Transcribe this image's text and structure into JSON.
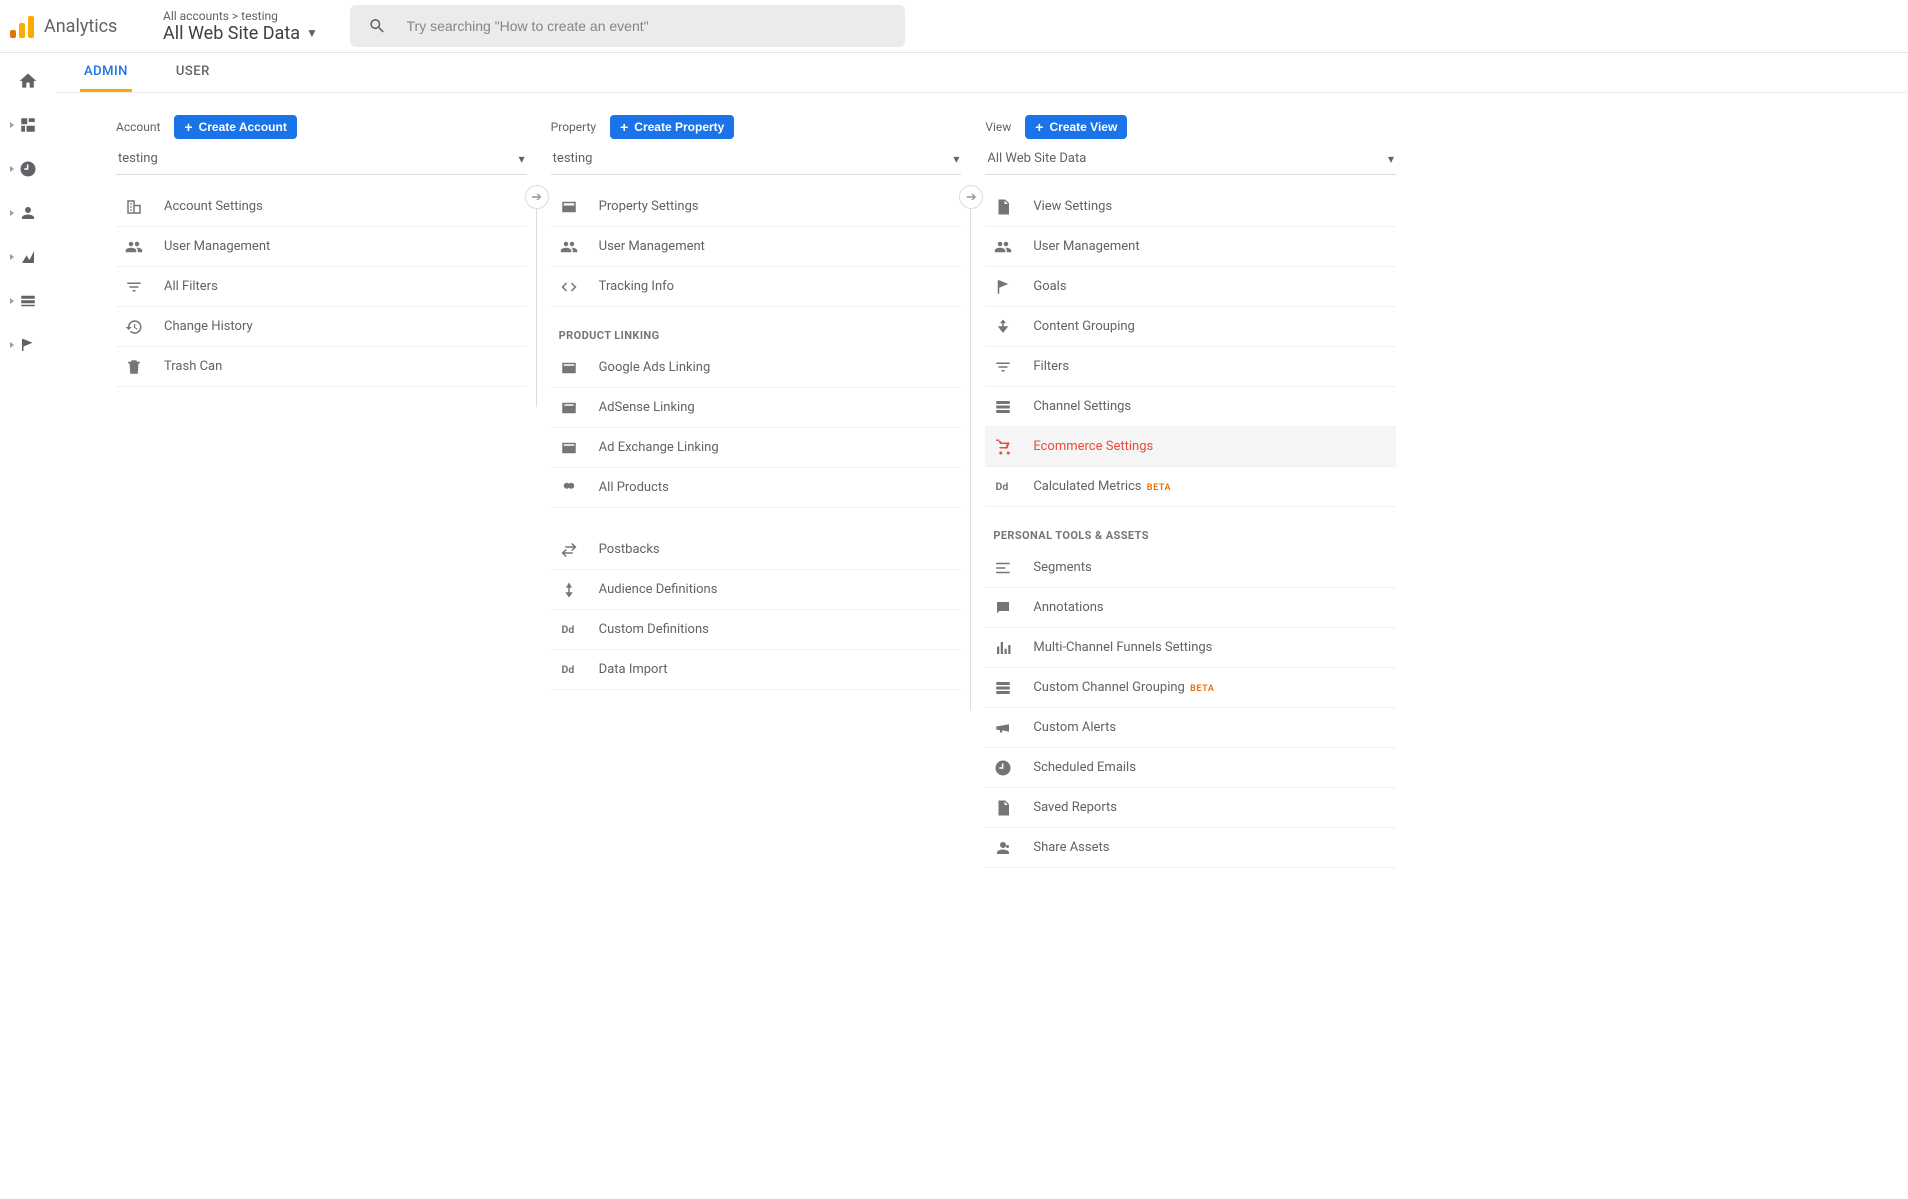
{
  "header": {
    "product_name": "Analytics",
    "breadcrumb_top": "All accounts > testing",
    "breadcrumb_main": "All Web Site Data",
    "search_placeholder": "Try searching \"How to create an event\""
  },
  "tabs": {
    "admin": "ADMIN",
    "user": "USER"
  },
  "columns": {
    "account": {
      "label": "Account",
      "create": "Create Account",
      "selector": "testing",
      "items": [
        {
          "id": "account-settings",
          "label": "Account Settings"
        },
        {
          "id": "account-user-management",
          "label": "User Management"
        },
        {
          "id": "account-all-filters",
          "label": "All Filters"
        },
        {
          "id": "account-change-history",
          "label": "Change History"
        },
        {
          "id": "account-trash-can",
          "label": "Trash Can"
        }
      ]
    },
    "property": {
      "label": "Property",
      "create": "Create Property",
      "selector": "testing",
      "items_main": [
        {
          "id": "property-settings",
          "label": "Property Settings"
        },
        {
          "id": "property-user-management",
          "label": "User Management"
        },
        {
          "id": "property-tracking-info",
          "label": "Tracking Info"
        }
      ],
      "section_product_linking": "PRODUCT LINKING",
      "items_linking": [
        {
          "id": "google-ads-linking",
          "label": "Google Ads Linking"
        },
        {
          "id": "adsense-linking",
          "label": "AdSense Linking"
        },
        {
          "id": "ad-exchange-linking",
          "label": "Ad Exchange Linking"
        },
        {
          "id": "all-products",
          "label": "All Products"
        }
      ],
      "items_lower": [
        {
          "id": "postbacks",
          "label": "Postbacks"
        },
        {
          "id": "audience-definitions",
          "label": "Audience Definitions"
        },
        {
          "id": "custom-definitions",
          "label": "Custom Definitions"
        },
        {
          "id": "data-import",
          "label": "Data Import"
        }
      ]
    },
    "view": {
      "label": "View",
      "create": "Create View",
      "selector": "All Web Site Data",
      "items_main": [
        {
          "id": "view-settings",
          "label": "View Settings"
        },
        {
          "id": "view-user-management",
          "label": "User Management"
        },
        {
          "id": "goals",
          "label": "Goals"
        },
        {
          "id": "content-grouping",
          "label": "Content Grouping"
        },
        {
          "id": "filters",
          "label": "Filters"
        },
        {
          "id": "channel-settings",
          "label": "Channel Settings"
        },
        {
          "id": "ecommerce-settings",
          "label": "Ecommerce Settings",
          "highlight": true
        },
        {
          "id": "calculated-metrics",
          "label": "Calculated Metrics",
          "badge": "BETA"
        }
      ],
      "section_personal": "PERSONAL TOOLS & ASSETS",
      "items_personal": [
        {
          "id": "segments",
          "label": "Segments"
        },
        {
          "id": "annotations",
          "label": "Annotations"
        },
        {
          "id": "mcf-settings",
          "label": "Multi-Channel Funnels Settings"
        },
        {
          "id": "custom-channel-grouping",
          "label": "Custom Channel Grouping",
          "badge": "BETA"
        },
        {
          "id": "custom-alerts",
          "label": "Custom Alerts"
        },
        {
          "id": "scheduled-emails",
          "label": "Scheduled Emails"
        },
        {
          "id": "saved-reports",
          "label": "Saved Reports"
        },
        {
          "id": "share-assets",
          "label": "Share Assets"
        }
      ]
    }
  }
}
